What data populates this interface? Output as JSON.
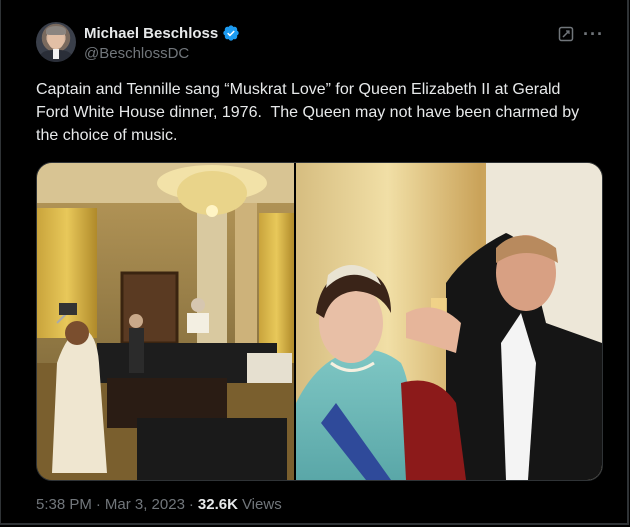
{
  "author": {
    "display_name": "Michael Beschloss",
    "handle": "@BeschlossDC"
  },
  "tweet": {
    "text": "Captain and Tennille sang “Muskrat Love” for Queen Elizabeth II at Gerald Ford White House dinner, 1976.  The Queen may not have been charmed by the choice of music."
  },
  "meta": {
    "time": "5:38 PM",
    "separator": "·",
    "date": "Mar 3, 2023",
    "separator2": "·",
    "views_count": "32.6K",
    "views_label": "Views"
  },
  "icons": {
    "verified": "verified-badge-icon",
    "grok": "grok-icon",
    "more": "more-icon"
  },
  "colors": {
    "background": "#000000",
    "text": "#e7e9ea",
    "muted": "#71767b",
    "verified": "#1d9bf0",
    "border": "#2f3336"
  }
}
